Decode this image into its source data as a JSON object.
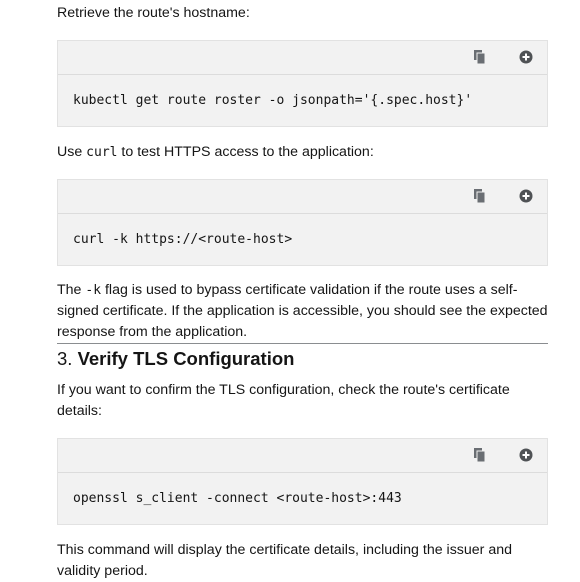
{
  "para1": "Retrieve the route's hostname:",
  "block1": {
    "command": "kubectl get route roster -o jsonpath='{.spec.host}'"
  },
  "para2": {
    "before": "Use ",
    "code": "curl",
    "after": " to test HTTPS access to the application:"
  },
  "block2": {
    "command": "curl -k https://<route-host>"
  },
  "para3": {
    "before": "The ",
    "code": "-k",
    "after": " flag is used to bypass certificate validation if the route uses a self-signed certificate. If the application is accessible, you should see the expected response from the application."
  },
  "section": {
    "number": "3.",
    "title": "Verify TLS Configuration"
  },
  "para4": "If you want to confirm the TLS configuration, check the route's certificate details:",
  "block3": {
    "command": "openssl s_client -connect <route-host>:443"
  },
  "para5": "This command will display the certificate details, including the issuer and validity period.",
  "icons": {
    "copy": "copy-icon",
    "expand": "plus-circle-icon"
  }
}
